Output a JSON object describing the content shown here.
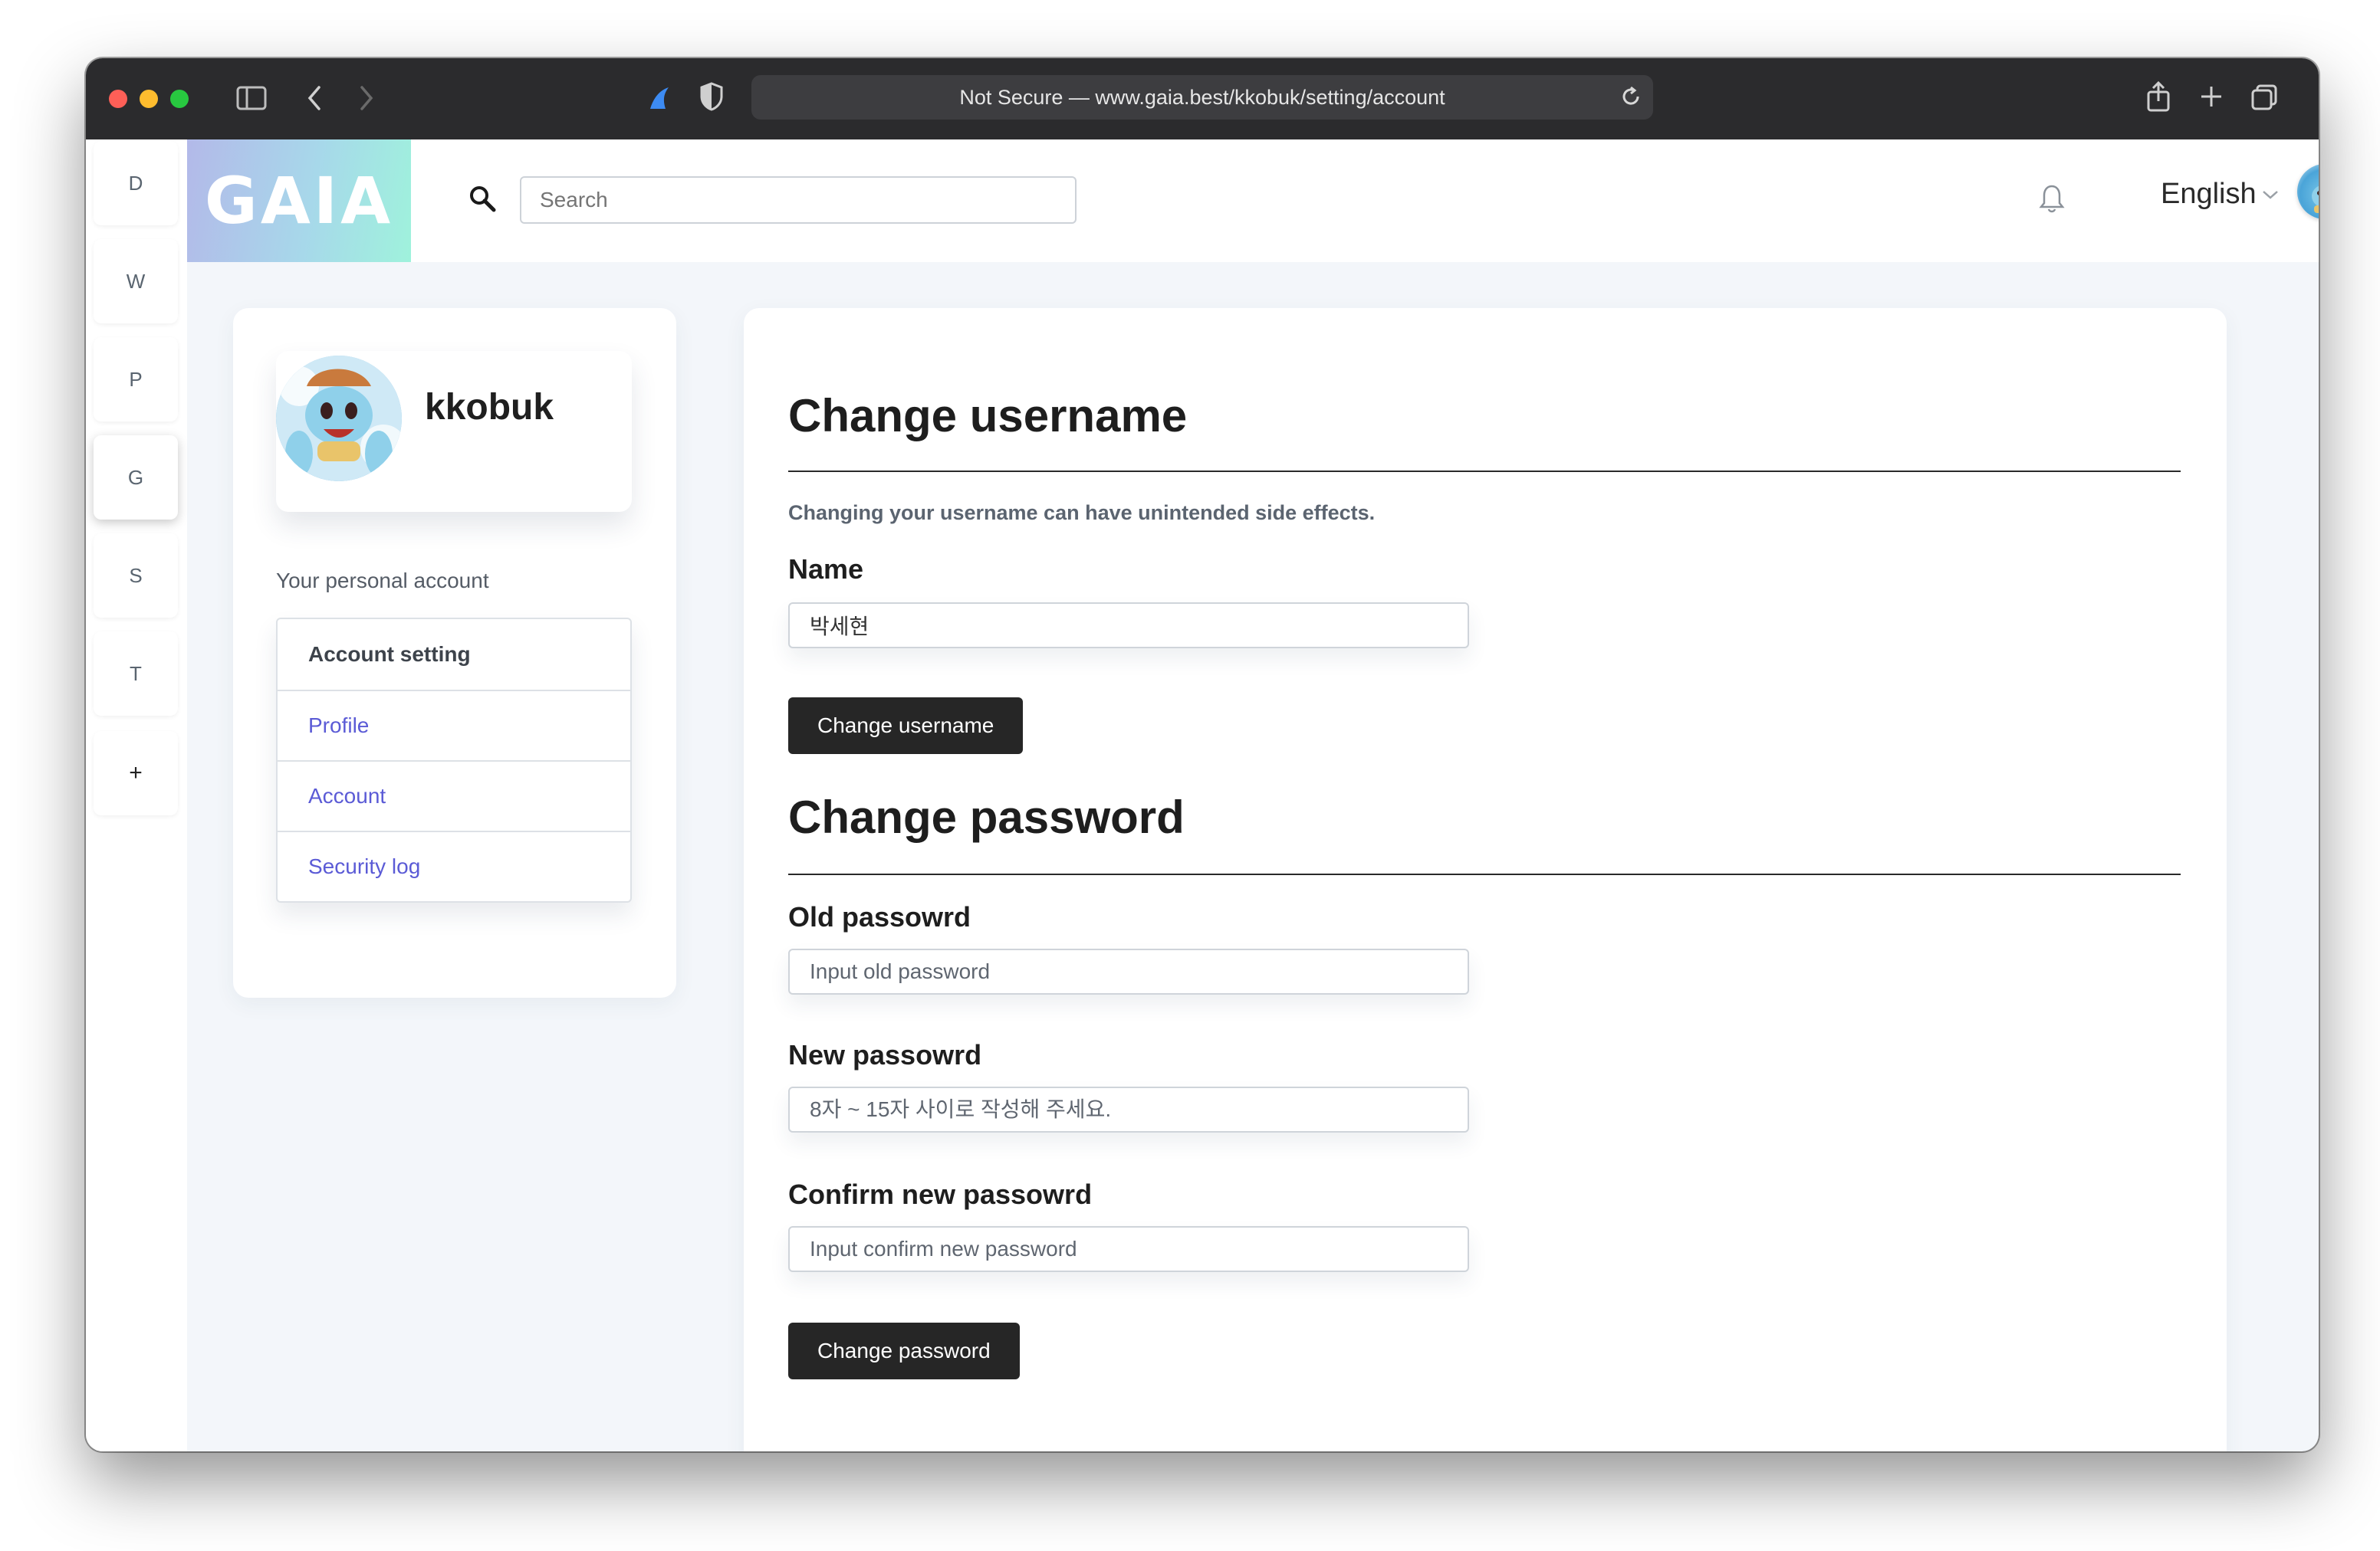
{
  "browser": {
    "url_text": "Not Secure — www.gaia.best/kkobuk/setting/account"
  },
  "rail": {
    "items": [
      "D",
      "W",
      "P",
      "G",
      "S",
      "T",
      "+"
    ],
    "active": "G"
  },
  "header": {
    "logo_text": "GAIA",
    "search_placeholder": "Search",
    "language": "English"
  },
  "sidebar": {
    "username": "kkobuk",
    "section_label": "Your personal account",
    "items": [
      {
        "label": "Account setting"
      },
      {
        "label": "Profile"
      },
      {
        "label": "Account"
      },
      {
        "label": "Security log"
      }
    ]
  },
  "change_username": {
    "title": "Change username",
    "note": "Changing your username can have unintended side effects.",
    "name_label": "Name",
    "name_value": "박세현",
    "button": "Change username"
  },
  "change_password": {
    "title": "Change password",
    "old_label": "Old passowrd",
    "old_placeholder": "Input old password",
    "new_label": "New passowrd",
    "new_placeholder": "8자 ~ 15자 사이로 작성해 주세요.",
    "confirm_label": "Confirm new passowrd",
    "confirm_placeholder": "Input confirm new password",
    "button": "Change password"
  },
  "colors": {
    "accent_link": "#5b5bd6",
    "button_dark": "#262626",
    "titlebar": "#2b2b2d"
  }
}
